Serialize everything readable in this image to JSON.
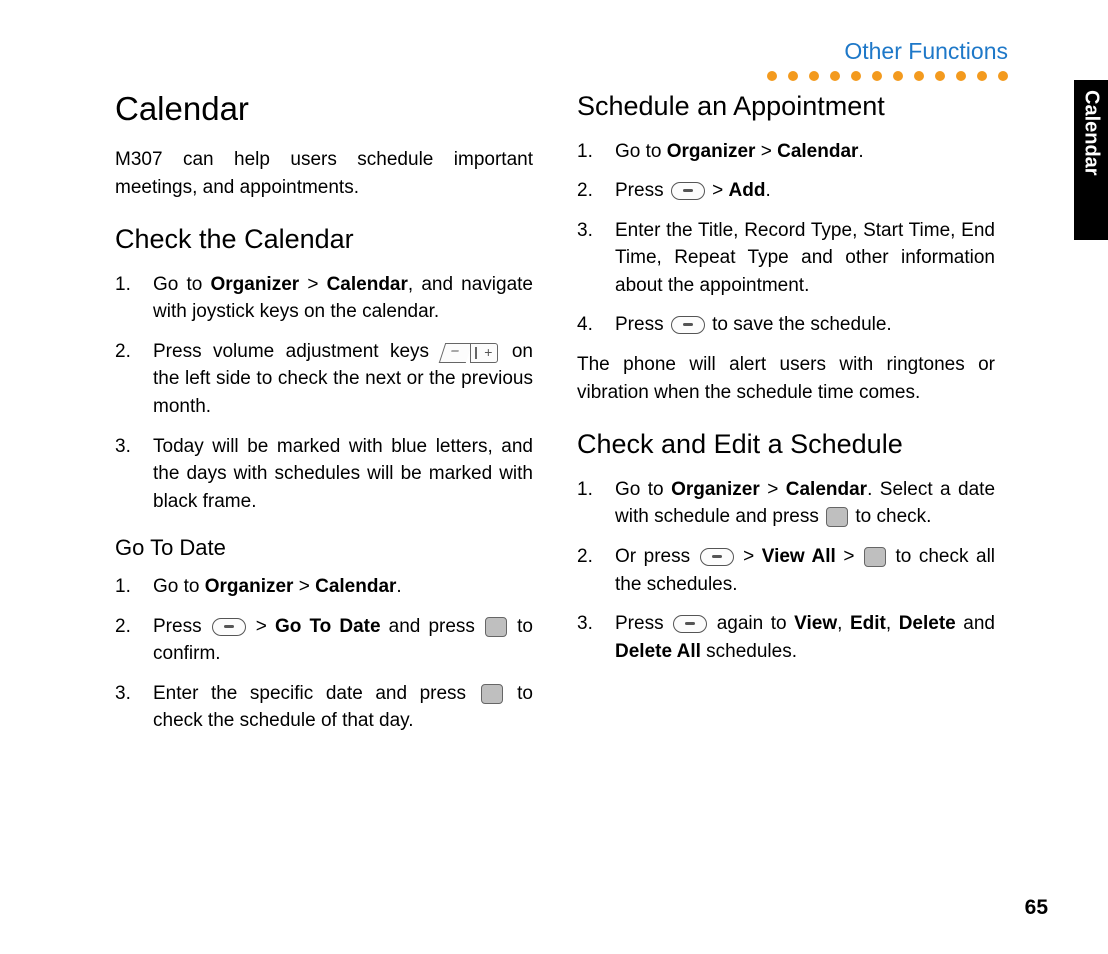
{
  "header": {
    "link": "Other Functions",
    "tab": "Calendar"
  },
  "page_number": "65",
  "left": {
    "title": "Calendar",
    "intro": "M307 can help users schedule important meetings, and appointments.",
    "check_heading": "Check the Calendar",
    "check_items": [
      {
        "pre": "Go to ",
        "b1": "Organizer",
        "mid": " > ",
        "b2": "Calendar",
        "post": ", and navigate with joystick keys on the calendar."
      },
      {
        "pre": "Press volume adjustment keys ",
        "icon": "volume",
        "post": " on the left side to check the next or the previous month."
      },
      {
        "text": "Today will be marked with blue letters, and the days with schedules will be marked with black frame."
      }
    ],
    "goto_heading": "Go To Date",
    "goto_items": [
      {
        "pre": "Go to ",
        "b1": "Organizer",
        "mid": " > ",
        "b2": "Calendar",
        "post": "."
      },
      {
        "pre": "Press ",
        "icon1": "soft",
        "mid1": " > ",
        "b1": "Go To Date",
        "mid2": " and press ",
        "icon2": "center",
        "post": " to confirm."
      },
      {
        "pre": "Enter the specific date and press ",
        "icon1": "center",
        "post": " to check the schedule of that day."
      }
    ]
  },
  "right": {
    "sched_heading": "Schedule an Appointment",
    "sched_items": [
      {
        "pre": "Go to ",
        "b1": "Organizer",
        "mid": " > ",
        "b2": "Calendar",
        "post": "."
      },
      {
        "pre": "Press ",
        "icon1": "soft",
        "mid1": " > ",
        "b1": "Add",
        "post": "."
      },
      {
        "text": "Enter the Title, Record Type, Start Time, End Time, Repeat Type and other information about the appointment."
      },
      {
        "pre": "Press ",
        "icon1": "soft",
        "post": " to save the schedule."
      }
    ],
    "sched_note": "The phone will alert users with ringtones or vibration when the schedule time comes.",
    "edit_heading": "Check and Edit a Schedule",
    "edit_items": [
      {
        "pre": "Go to ",
        "b1": "Organizer",
        "mid": " > ",
        "b2": "Calendar",
        "post1": ". Select a date with schedule and press ",
        "icon1": "center",
        "post2": " to check."
      },
      {
        "pre": "Or press ",
        "icon1": "soft",
        "mid1": " > ",
        "b1": "View All",
        "mid2": " > ",
        "icon2": "center",
        "post": " to check all the schedules."
      },
      {
        "pre": "Press ",
        "icon1": "soft",
        "mid1": " again to ",
        "b1": "View",
        "c1": ", ",
        "b2": "Edit",
        "c2": ", ",
        "b3": "Delete",
        "mid2": " and ",
        "b4": "Delete All",
        "post": " schedules."
      }
    ]
  }
}
